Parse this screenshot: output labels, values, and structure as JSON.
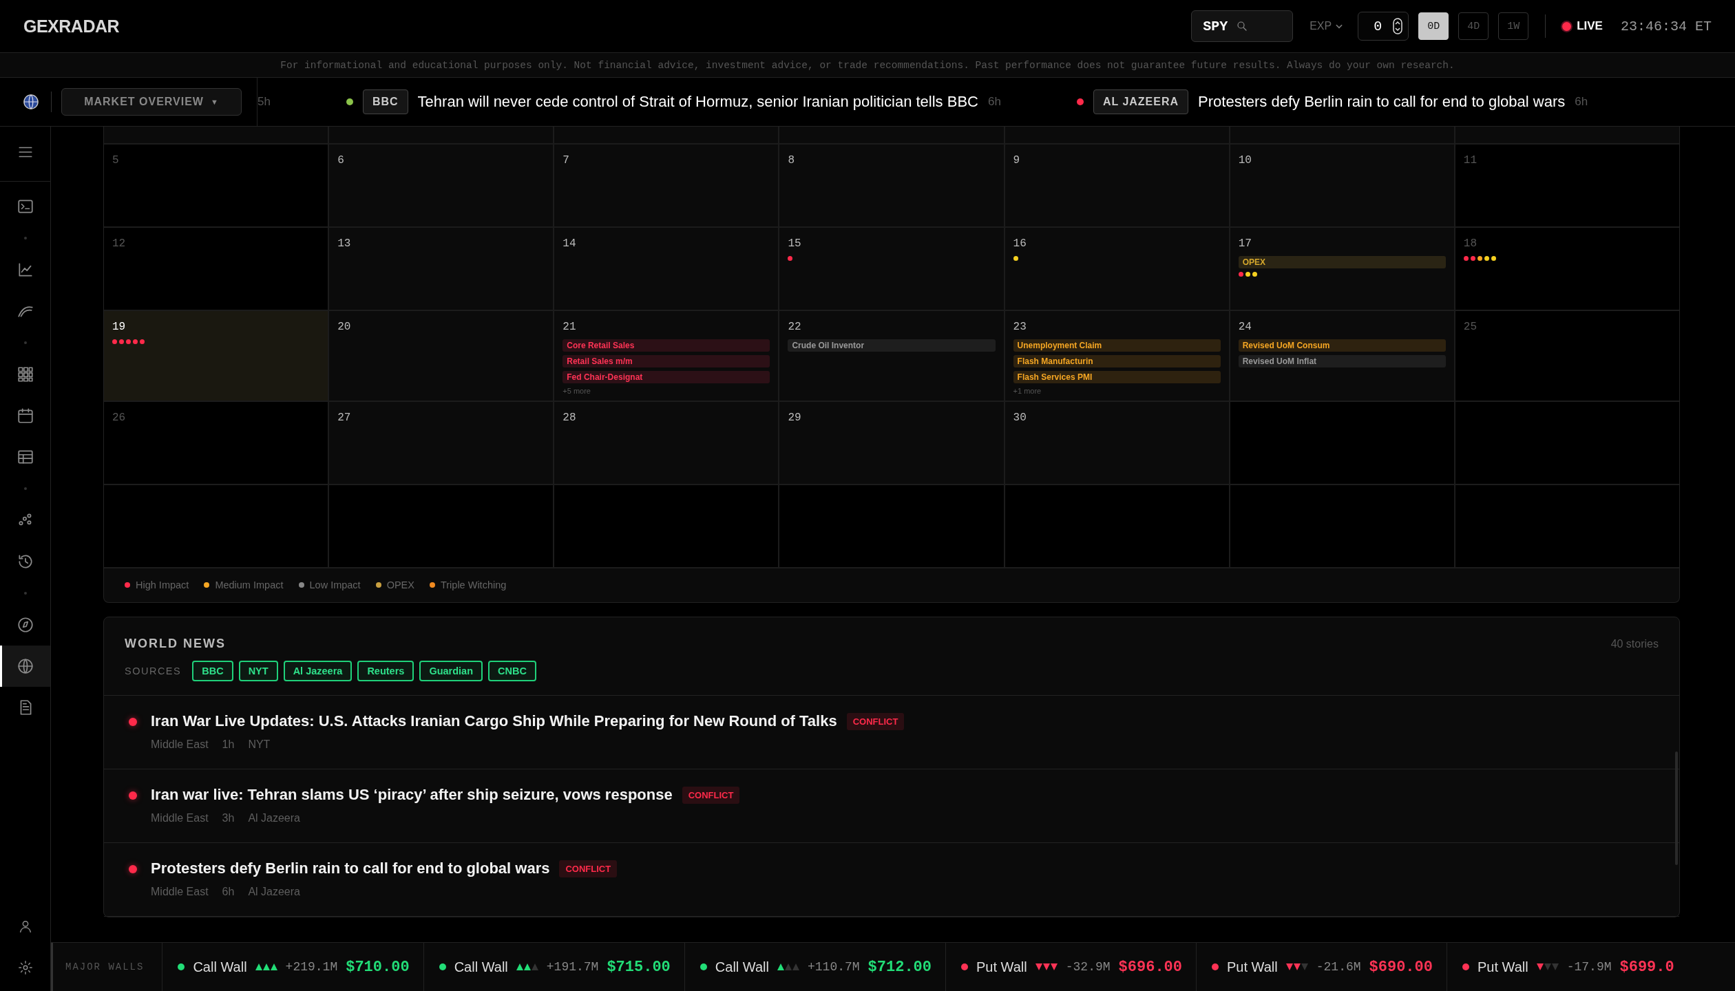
{
  "header": {
    "logo": "GEXRADAR",
    "symbol": "SPY",
    "exp_label": "EXP",
    "exp_value": "0",
    "ranges": [
      {
        "label": "0D",
        "selected": true
      },
      {
        "label": "4D",
        "selected": false
      },
      {
        "label": "1W",
        "selected": false
      }
    ],
    "live": "LIVE",
    "time": "23:46:34 ET"
  },
  "disclaimer": "For informational and educational purposes only. Not financial advice, investment advice, or trade recommendations. Past performance does not guarantee future results. Always do your own research.",
  "ticker": {
    "menu": "MARKET OVERVIEW",
    "menu_arrow": "▼",
    "items": [
      {
        "time": "5h"
      },
      {
        "color": "#8bc34a",
        "source": "BBC",
        "headline": "Tehran will never cede control of Strait of Hormuz, senior Iranian politician tells BBC",
        "time": "6h"
      },
      {
        "color": "#ff2a4a",
        "source": "AL JAZEERA",
        "headline": "Protesters defy Berlin rain to call for end to global wars",
        "time": "6h"
      }
    ]
  },
  "sidebar": {
    "items": [
      {
        "selected": false
      },
      {
        "selected": false
      },
      {
        "selected": false
      },
      {
        "selected": false
      },
      {
        "selected": false
      },
      {
        "selected": false
      },
      {
        "selected": false
      },
      {
        "selected": false
      },
      {
        "selected": false
      },
      {
        "selected": false
      },
      {
        "selected": true
      },
      {
        "selected": false
      }
    ],
    "bottom_items": [
      {
        "selected": false
      },
      {
        "selected": false
      }
    ]
  },
  "calendar": {
    "weeks": [
      [
        {
          "kind": "weekend",
          "day": "5"
        },
        {
          "kind": "weekday",
          "day": "6"
        },
        {
          "kind": "weekday",
          "day": "7"
        },
        {
          "kind": "weekday",
          "day": "8"
        },
        {
          "kind": "weekday",
          "day": "9"
        },
        {
          "kind": "weekday",
          "day": "10"
        },
        {
          "kind": "weekend",
          "day": "11"
        }
      ],
      [
        {
          "kind": "weekend",
          "day": "12"
        },
        {
          "kind": "weekday",
          "day": "13"
        },
        {
          "kind": "weekday",
          "day": "14"
        },
        {
          "kind": "weekday",
          "day": "15",
          "dots": [
            {
              "color": "#ff2a4a"
            }
          ]
        },
        {
          "kind": "weekday",
          "day": "16",
          "dots": [
            {
              "color": "#f5d020"
            }
          ]
        },
        {
          "kind": "weekday",
          "day": "17",
          "events": [
            {
              "kind": "opex",
              "label": "OPEX"
            }
          ],
          "dots": [
            {
              "color": "#ff2a4a"
            },
            {
              "color": "#f5d020"
            },
            {
              "color": "#f5d020"
            }
          ]
        },
        {
          "kind": "weekend",
          "day": "18",
          "dots": [
            {
              "color": "#ff2a4a"
            },
            {
              "color": "#ff2a4a"
            },
            {
              "color": "#f5a623"
            },
            {
              "color": "#f5d020"
            },
            {
              "color": "#f5d020"
            }
          ]
        }
      ],
      [
        {
          "kind": "today",
          "day": "19",
          "dots": [
            {
              "color": "#ff2a4a"
            },
            {
              "color": "#ff2a4a"
            },
            {
              "color": "#ff2a4a"
            },
            {
              "color": "#ff2a4a"
            },
            {
              "color": "#ff2a4a"
            }
          ]
        },
        {
          "kind": "weekday",
          "day": "20"
        },
        {
          "kind": "weekday",
          "day": "21",
          "events": [
            {
              "kind": "high",
              "label": "Core Retail Sales"
            },
            {
              "kind": "high",
              "label": "Retail Sales m/m"
            },
            {
              "kind": "high",
              "label": "Fed Chair-Designat"
            }
          ],
          "more": "+5 more"
        },
        {
          "kind": "weekday",
          "day": "22",
          "events": [
            {
              "kind": "low",
              "label": "Crude Oil Inventor"
            }
          ]
        },
        {
          "kind": "weekday",
          "day": "23",
          "events": [
            {
              "kind": "medium",
              "label": "Unemployment Claim"
            },
            {
              "kind": "medium",
              "label": "Flash Manufacturin"
            },
            {
              "kind": "medium",
              "label": "Flash Services PMI"
            }
          ],
          "more": "+1 more"
        },
        {
          "kind": "weekday",
          "day": "24",
          "events": [
            {
              "kind": "medium",
              "label": "Revised UoM Consum"
            },
            {
              "kind": "low",
              "label": "Revised UoM Inflat"
            }
          ]
        },
        {
          "kind": "weekend",
          "day": "25"
        }
      ],
      [
        {
          "kind": "weekend",
          "day": "26"
        },
        {
          "kind": "weekday",
          "day": "27"
        },
        {
          "kind": "weekday",
          "day": "28"
        },
        {
          "kind": "weekday",
          "day": "29"
        },
        {
          "kind": "weekday",
          "day": "30"
        },
        {
          "kind": "empty"
        },
        {
          "kind": "empty"
        }
      ],
      [
        {
          "kind": "empty"
        },
        {
          "kind": "empty"
        },
        {
          "kind": "empty"
        },
        {
          "kind": "empty"
        },
        {
          "kind": "empty"
        },
        {
          "kind": "empty"
        },
        {
          "kind": "empty"
        }
      ]
    ],
    "legend": [
      {
        "label": "High Impact",
        "color": "#ff2a4a"
      },
      {
        "label": "Medium Impact",
        "color": "#f5a623"
      },
      {
        "label": "Low Impact",
        "color": "#888888"
      },
      {
        "label": "OPEX",
        "color": "#c9a040"
      },
      {
        "label": "Triple Witching",
        "color": "#f08a20"
      }
    ]
  },
  "news": {
    "title": "WORLD NEWS",
    "count": "40 stories",
    "sources_label": "SOURCES",
    "sources": [
      {
        "label": "BBC",
        "selected": true
      },
      {
        "label": "NYT",
        "selected": true
      },
      {
        "label": "Al Jazeera",
        "selected": true
      },
      {
        "label": "Reuters",
        "selected": true
      },
      {
        "label": "Guardian",
        "selected": true
      },
      {
        "label": "CNBC",
        "selected": true
      }
    ],
    "items": [
      {
        "title": "Iran War Live Updates: U.S. Attacks Iranian Cargo Ship While Preparing for New Round of Talks",
        "tag": "CONFLICT",
        "region": "Middle East",
        "time": "1h",
        "source": "NYT"
      },
      {
        "title": "Iran war live: Tehran slams US ‘piracy’ after ship seizure, vows response",
        "tag": "CONFLICT",
        "region": "Middle East",
        "time": "3h",
        "source": "Al Jazeera"
      },
      {
        "title": "Protesters defy Berlin rain to call for end to global wars",
        "tag": "CONFLICT",
        "region": "Middle East",
        "time": "6h",
        "source": "Al Jazeera"
      }
    ]
  },
  "walls": {
    "label": "MAJOR WALLS",
    "items": [
      {
        "kind": "call",
        "label": "Call Wall",
        "stars": 3,
        "change": "+219.1M",
        "price": "$710.00"
      },
      {
        "kind": "call",
        "label": "Call Wall",
        "stars": 2,
        "change": "+191.7M",
        "price": "$715.00"
      },
      {
        "kind": "call",
        "label": "Call Wall",
        "stars": 1,
        "change": "+110.7M",
        "price": "$712.00"
      },
      {
        "kind": "put",
        "label": "Put Wall",
        "stars": 3,
        "change": "-32.9M",
        "price": "$696.00"
      },
      {
        "kind": "put",
        "label": "Put Wall",
        "stars": 2,
        "change": "-21.6M",
        "price": "$690.00"
      },
      {
        "kind": "put",
        "label": "Put Wall",
        "stars": 1,
        "change": "-17.9M",
        "price": "$699.0"
      }
    ]
  }
}
